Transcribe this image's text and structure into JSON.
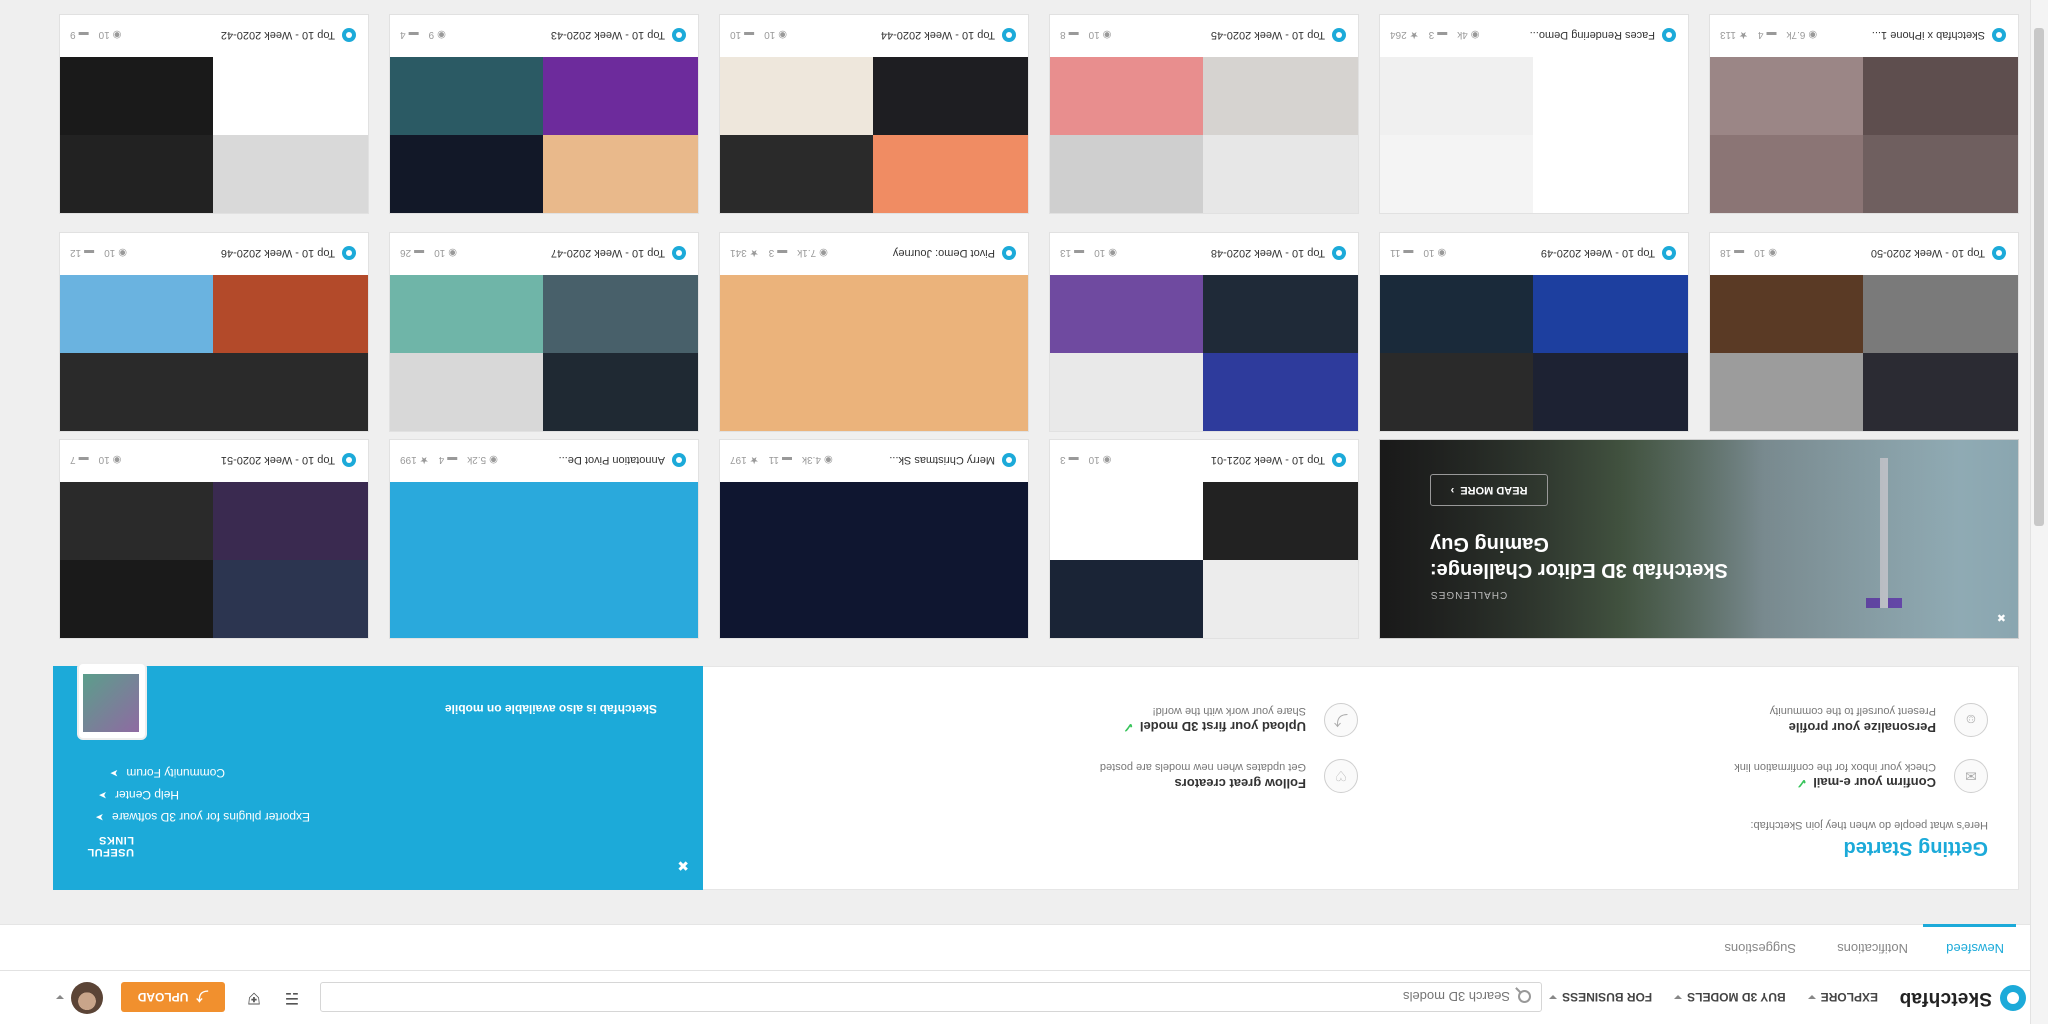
{
  "header": {
    "logo_text": "Sketchfab",
    "nav": [
      "EXPLORE",
      "BUY 3D MODELS",
      "FOR BUSINESS"
    ],
    "search_placeholder": "Search 3D models",
    "upload_label": "UPLOAD"
  },
  "tabs": [
    "Newsfeed",
    "Notifications",
    "Suggestions"
  ],
  "getting_started": {
    "title": "Getting Started",
    "subtitle": "Here's what people do when they join Sketchfab:",
    "tasks": [
      {
        "title": "Personalize your profile",
        "desc": "Present yourself to the community",
        "done": false
      },
      {
        "title": "Upload your first 3D model",
        "desc": "Share your work with the world!",
        "done": true
      },
      {
        "title": "Confirm your e-mail",
        "desc": "Check your inbox for the confirmation link",
        "done": true
      },
      {
        "title": "Follow great creators",
        "desc": "Get updates when new models are posted",
        "done": false
      }
    ]
  },
  "useful_links": {
    "title": "USEFUL LINKS",
    "items": [
      "Exporter plugins for your 3D software",
      "Help Center",
      "Community Forum"
    ],
    "mobile_text": "Sketchfab is also available on mobile"
  },
  "challenge": {
    "label": "CHALLENGES",
    "title_line1": "Sketchfab 3D Editor Challenge:",
    "title_line2": "Gaming Guy",
    "button": "READ MORE"
  },
  "cards_row3": [
    {
      "title": "Top 10 - Week 2021-01",
      "s1": "10",
      "s2": "3"
    },
    {
      "title": "Merry Christmas Sk...",
      "s1": "4.3k",
      "s2": "11",
      "s3": "197"
    },
    {
      "title": "Annotation Pivot De...",
      "s1": "5.2k",
      "s2": "4",
      "s3": "199"
    },
    {
      "title": "Top 10 - Week 2020-51",
      "s1": "10",
      "s2": "7"
    }
  ],
  "cards_row2": [
    {
      "title": "Top 10 - Week 2020-50",
      "s1": "10",
      "s2": "18"
    },
    {
      "title": "Top 10 - Week 2020-49",
      "s1": "10",
      "s2": "11"
    },
    {
      "title": "Top 10 - Week 2020-48",
      "s1": "10",
      "s2": "13"
    },
    {
      "title": "Pivot Demo: Journey",
      "s1": "7.1k",
      "s2": "3",
      "s3": "341"
    },
    {
      "title": "Top 10 - Week 2020-47",
      "s1": "10",
      "s2": "26"
    },
    {
      "title": "Top 10 - Week 2020-46",
      "s1": "10",
      "s2": "12"
    }
  ],
  "cards_row1": [
    {
      "title": "Sketchfab x iPhone 1...",
      "s1": "6.7k",
      "s2": "4",
      "s3": "113"
    },
    {
      "title": "Faces Rendering Demo...",
      "s1": "4k",
      "s2": "3",
      "s3": "264"
    },
    {
      "title": "Top 10 - Week 2020-45",
      "s1": "10",
      "s2": "8"
    },
    {
      "title": "Top 10 - Week 2020-44",
      "s1": "10",
      "s2": "10"
    },
    {
      "title": "Top 10 - Week 2020-43",
      "s1": "9",
      "s2": "4"
    },
    {
      "title": "Top 10 - Week 2020-42",
      "s1": "10",
      "s2": "9"
    }
  ]
}
